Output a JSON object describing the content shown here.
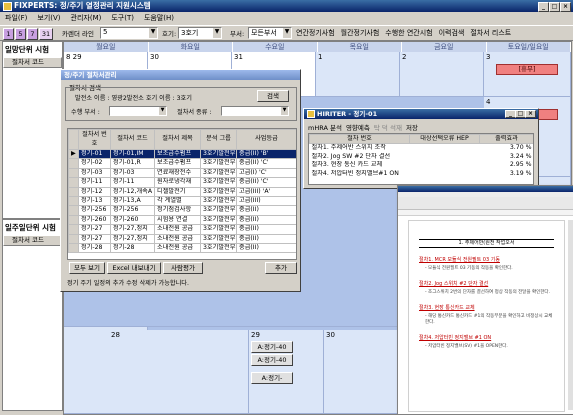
{
  "app": {
    "title": "FIXPERTS: 정/주기 열정관리 지원시스템",
    "menu": [
      "파일(F)",
      "보기(V)",
      "관리자(M)",
      "도구(T)",
      "도움말(H)"
    ],
    "toolbar": {
      "day_buttons": [
        "1",
        "5",
        "7",
        "31"
      ],
      "calendar_label": "카렌더 라인",
      "calendar_value": "5",
      "unit_label": "호기:",
      "unit_value": "3호기",
      "dept_label": "부서:",
      "dept_value": "모든부서",
      "links": [
        "연간정기사험",
        "월간정기사험",
        "수행한 연간시험",
        "이력검색",
        "절차서 리스트"
      ]
    }
  },
  "left": {
    "daily_title": "일망단위 시험",
    "daily_header": "절차서 코드",
    "weekly_title": "일주일단위 시험",
    "weekly_header": "절차서 코드"
  },
  "calendar": {
    "weekdays": [
      "월요일",
      "화요일",
      "수요일",
      "목요일",
      "금요일",
      "토요일/일요일"
    ],
    "row1": [
      "8 29",
      "30",
      "31",
      "1",
      "2",
      "3"
    ],
    "row2_right": "4",
    "row_bottom": [
      "",
      "28",
      "29",
      "30"
    ],
    "holiday_label": "[휴무]",
    "bottom_items": [
      "A:정기-40",
      "A:정기-40",
      "A:정기-"
    ]
  },
  "proc_dialog": {
    "title": "정/주기 절차서관리",
    "group_label": "절차서 검색",
    "search_row": "발전소 이름 : 영광2발전소  호기 이름 : 3호기",
    "search_button": "검색",
    "dept_label": "수행 부서 :",
    "type_label": "절차서 종류 :",
    "columns": [
      "절차서 번호",
      "절차서 코드",
      "절차서 제목",
      "분석 그룹",
      "사업등급"
    ],
    "rows": [
      [
        "정기-01",
        "정기-01,IM",
        "보조급수펌프",
        "3호기발전부",
        "중급(II) 'B'"
      ],
      [
        "정기-02",
        "정기-01,R",
        "보조급수펌프",
        "3호기발전부",
        "중급(II) 'C'"
      ],
      [
        "정기-03",
        "정기-03",
        "연료재장전수",
        "3호기발전부",
        "고급(I) 'C'"
      ],
      [
        "정기-11",
        "정기-11",
        "원자로냉각재",
        "3호기발전부",
        "중급(II) 'C'"
      ],
      [
        "정기-12",
        "정기-12,개속A",
        "디젤발전기",
        "3호기발전부",
        "고급(III) 'A'"
      ],
      [
        "정기-13",
        "정기-13,A",
        "각 계열별",
        "3호기발전부",
        "고급(III)"
      ],
      [
        "정기-256",
        "정기-256",
        "정기점검사항",
        "3호기발전부",
        "중급(II)"
      ],
      [
        "정기-260",
        "정기-260",
        "시험용 연결",
        "3호기발전부",
        "중급(II)"
      ],
      [
        "정기-27",
        "정기-27,정지",
        "소내전원 공급",
        "3호기발전부",
        "중급(II)"
      ],
      [
        "정기-27",
        "정기-27,정지",
        "소내전원 공급",
        "3호기발전부",
        "중급(II)"
      ],
      [
        "정기-28",
        "정기-28",
        "소내전원 공급",
        "3호기발전부",
        "중급(II)"
      ]
    ],
    "buttons": [
      "모두 보기",
      "Excel 내보내기",
      "사람평가",
      "추가"
    ],
    "status": "정기 주기 일정의 추가 수정 삭제가 가능합니다."
  },
  "hiriter": {
    "title": "HIRITER - 정기-01",
    "tabs": [
      "mHRA 분석",
      "영향예측",
      "탁 덕 석재",
      "저장"
    ],
    "columns": [
      "절차 번호",
      "대상선택오류 HEP",
      "출력효과"
    ],
    "rows": [
      [
        "절차1. 주제어반 스위치 조작",
        "3.70 %"
      ],
      [
        "절차2. Jog SW #2 단자 결선",
        "3.24 %"
      ],
      [
        "절차3. 현장 통신 카드 교체",
        "2.95 %"
      ],
      [
        "절차4. 저압터빈 정지밸브#1 ON",
        "3.19 %"
      ]
    ]
  },
  "doc": {
    "heading": "1. 주제어반(원전 작업오서",
    "steps": [
      {
        "title": "절차1. MCR 모듈식 전원필트 03 기동",
        "body": "- 모듈식 전원필트 03 기동의 작동을 확인한다."
      },
      {
        "title": "절차2. Jog 스위치 #2 단자 결선",
        "body": "- 조그스위치 2번의 단자를 결선하여 정상 작동의 전달을 확인한다."
      },
      {
        "title": "절차3. 현장 통신카드 교체",
        "body": "- 해당 통신카드 통신카드 #1의 작동부분을 확인하고 비정상시 교체한다."
      },
      {
        "title": "절차4. 저압터빈 정지밸브 #1 ON",
        "body": "- 저압터빈 정지밸브(SV) #1을 OPEN한다."
      }
    ]
  }
}
